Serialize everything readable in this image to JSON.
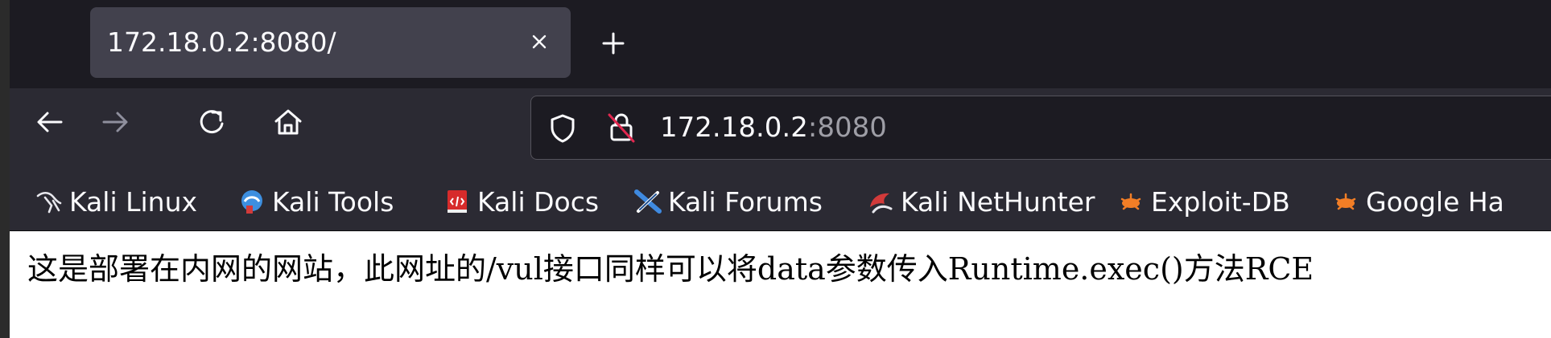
{
  "tab": {
    "title": "172.18.0.2:8080/",
    "close_icon": "close-icon",
    "new_tab_icon": "plus-icon"
  },
  "nav": {
    "back_icon": "arrow-left-icon",
    "forward_icon": "arrow-right-icon",
    "reload_icon": "reload-icon",
    "home_icon": "home-icon"
  },
  "urlbar": {
    "host": "172.18.0.2",
    "port": ":8080",
    "tracking_icon": "shield-icon",
    "lock_icon": "insecure-lock-icon"
  },
  "bookmarks": [
    {
      "label": "Kali Linux",
      "icon": "kali-dragon-icon"
    },
    {
      "label": "Kali Tools",
      "icon": "kali-tools-icon"
    },
    {
      "label": "Kali Docs",
      "icon": "kali-docs-icon"
    },
    {
      "label": "Kali Forums",
      "icon": "kali-forums-icon"
    },
    {
      "label": "Kali NetHunter",
      "icon": "kali-nethunter-icon"
    },
    {
      "label": "Exploit-DB",
      "icon": "exploit-db-icon"
    },
    {
      "label": "Google Ha",
      "icon": "google-hacking-icon"
    }
  ],
  "page": {
    "text": "这是部署在内网的网站，此网址的/vul接口同样可以将data参数传入Runtime.exec()方法RCE"
  },
  "colors": {
    "tabstrip": "#1c1b22",
    "toolbar": "#2b2a33",
    "active_tab": "#42414d",
    "text_light": "#fbfbfe",
    "port_gray": "#9e9ea6",
    "exploit_orange": "#f27e26"
  }
}
